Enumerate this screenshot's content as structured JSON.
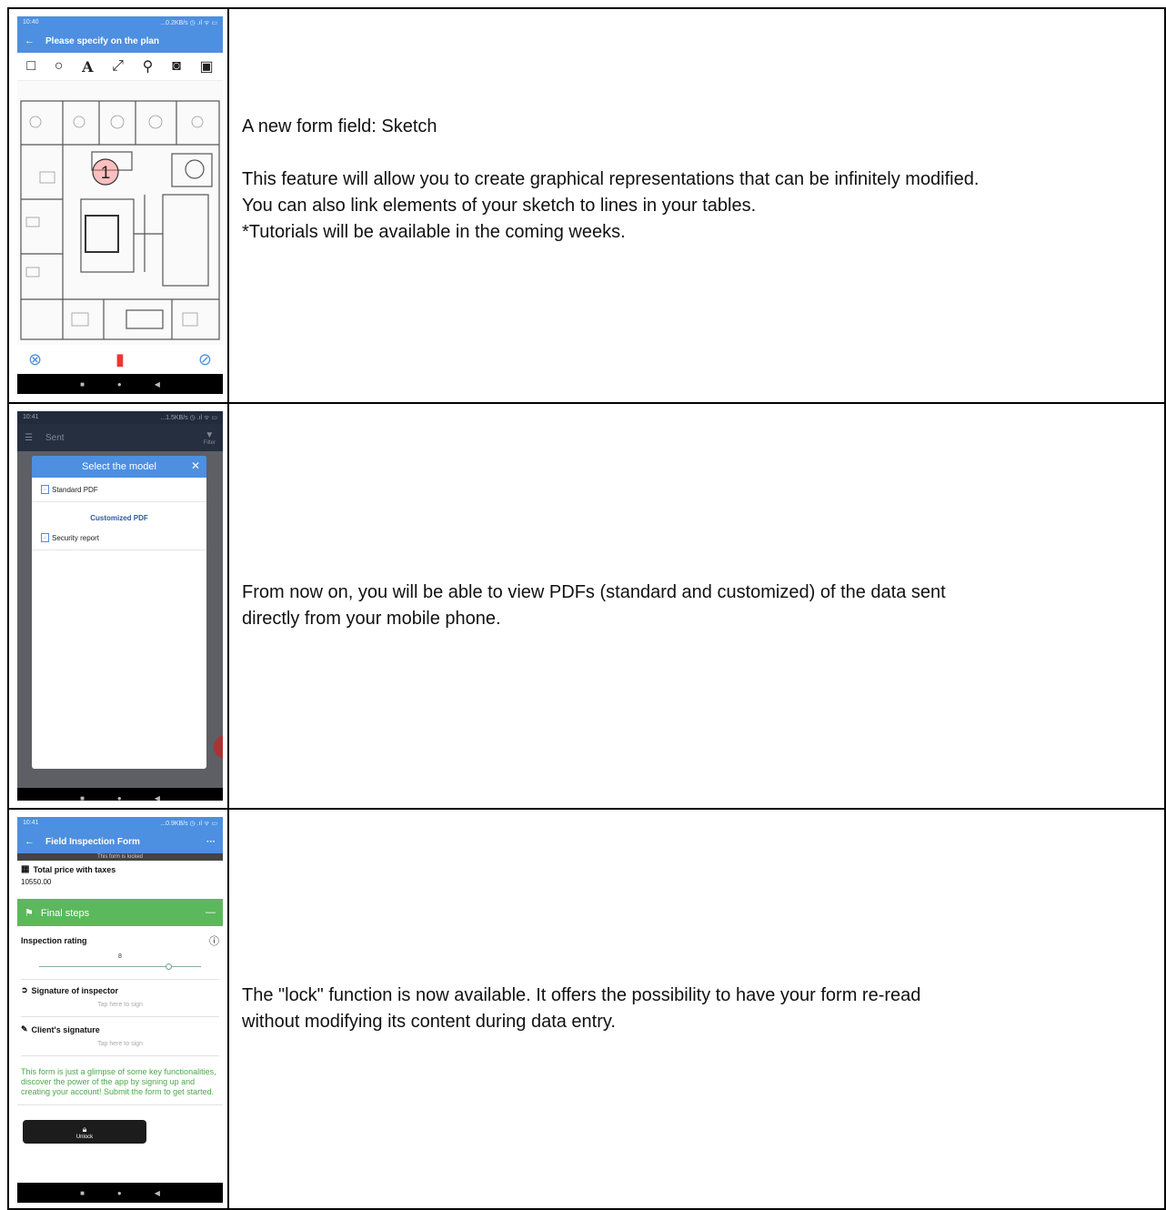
{
  "rows": [
    {
      "screen": {
        "status_time": "10:40",
        "status_right": "...0.2KB/s ◷ .ıl ᯤ ▭",
        "back_icon": "back-arrow-icon",
        "title": "Please specify on the plan",
        "tools": [
          "rectangle-icon",
          "circle-icon",
          "text-icon",
          "arrow-icon",
          "link-icon",
          "camera-icon",
          "image-icon"
        ],
        "marker_number": "1",
        "actions": [
          "cancel-icon",
          "trash-icon",
          "confirm-icon"
        ],
        "accent": "#4d8fe0",
        "trash_color": "#e53935"
      },
      "text": {
        "heading": "A new form field: Sketch",
        "line1": "This feature will allow you to create graphical representations that can be infinitely modified.",
        "line2": "You can also link elements of your sketch to lines in your tables.",
        "line3": "*Tutorials will be available in the coming weeks."
      }
    },
    {
      "screen": {
        "status_time": "10:41",
        "status_right": "...1.5KB/s ◷ .ıl ᯤ ▭",
        "bg_title": "Sent",
        "bg_filter": "Filter",
        "dialog_title": "Select the model",
        "item_standard": "Standard PDF",
        "section_custom": "Customized PDF",
        "item_security": "Security report"
      },
      "text": {
        "line1": "From now on, you will be able to view PDFs (standard and customized) of the data sent",
        "line2": "directly from your mobile phone."
      }
    },
    {
      "screen": {
        "status_time": "10:41",
        "status_right": "...0.9KB/s ◷ .ıl ᯤ ▭",
        "title": "Field Inspection Form",
        "more": "···",
        "locked_banner": "This form is locked",
        "total_label": "Total price with taxes",
        "total_value": "10550.00",
        "section": "Final steps",
        "section_collapse": "—",
        "rating_label": "Inspection rating",
        "rating_value": "8",
        "rating_fraction": 0.8,
        "sig_inspector": "Signature of inspector",
        "tap_sign_1": "Tap here to sign",
        "sig_client": "Client's signature",
        "tap_sign_2": "Tap here to sign",
        "promo": "This form is just a glimpse of some key functionalities, discover the power of the app by signing up and creating your account! Submit the form to get started.",
        "unlock_label": "Unlock",
        "green": "#5cb85c"
      },
      "text": {
        "line1": "The \"lock\" function is now available. It offers the possibility to have your form re-read",
        "line2": "without modifying its content during data entry."
      }
    }
  ]
}
